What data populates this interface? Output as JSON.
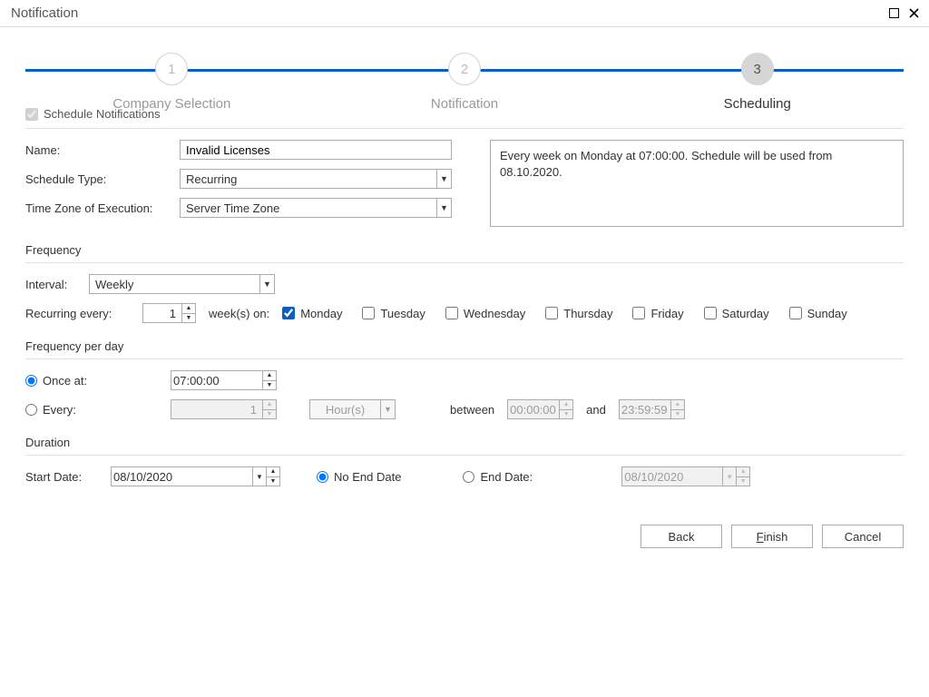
{
  "titlebar": {
    "title": "Notification"
  },
  "stepper": {
    "steps": [
      {
        "num": "1",
        "label": "Company Selection"
      },
      {
        "num": "2",
        "label": "Notification"
      },
      {
        "num": "3",
        "label": "Scheduling"
      }
    ],
    "active_index": 2
  },
  "schedule": {
    "checkbox_label": "Schedule Notifications",
    "name_label": "Name:",
    "name_value": "Invalid Licenses",
    "type_label": "Schedule Type:",
    "type_value": "Recurring",
    "tz_label": "Time Zone of Execution:",
    "tz_value": "Server Time Zone",
    "summary": "Every week on Monday at 07:00:00. Schedule will be used from 08.10.2020."
  },
  "frequency": {
    "heading": "Frequency",
    "interval_label": "Interval:",
    "interval_value": "Weekly",
    "recurring_label": "Recurring every:",
    "recurring_value": "1",
    "recurring_unit": "week(s) on:",
    "days": {
      "mon": "Monday",
      "tue": "Tuesday",
      "wed": "Wednesday",
      "thu": "Thursday",
      "fri": "Friday",
      "sat": "Saturday",
      "sun": "Sunday"
    },
    "days_checked": {
      "mon": true,
      "tue": false,
      "wed": false,
      "thu": false,
      "fri": false,
      "sat": false,
      "sun": false
    }
  },
  "freq_per_day": {
    "heading": "Frequency per day",
    "once_label": "Once at:",
    "once_value": "07:00:00",
    "every_label": "Every:",
    "every_value": "1",
    "every_unit": "Hour(s)",
    "between_label": "between",
    "and_label": "and",
    "between_from": "00:00:00",
    "between_to": "23:59:59"
  },
  "duration": {
    "heading": "Duration",
    "start_label": "Start Date:",
    "start_value": "08/10/2020",
    "no_end_label": "No End Date",
    "end_label": "End Date:",
    "end_value": "08/10/2020"
  },
  "footer": {
    "back": "Back",
    "finish_pre": "",
    "finish_u": "F",
    "finish_rest": "inish",
    "cancel": "Cancel"
  }
}
